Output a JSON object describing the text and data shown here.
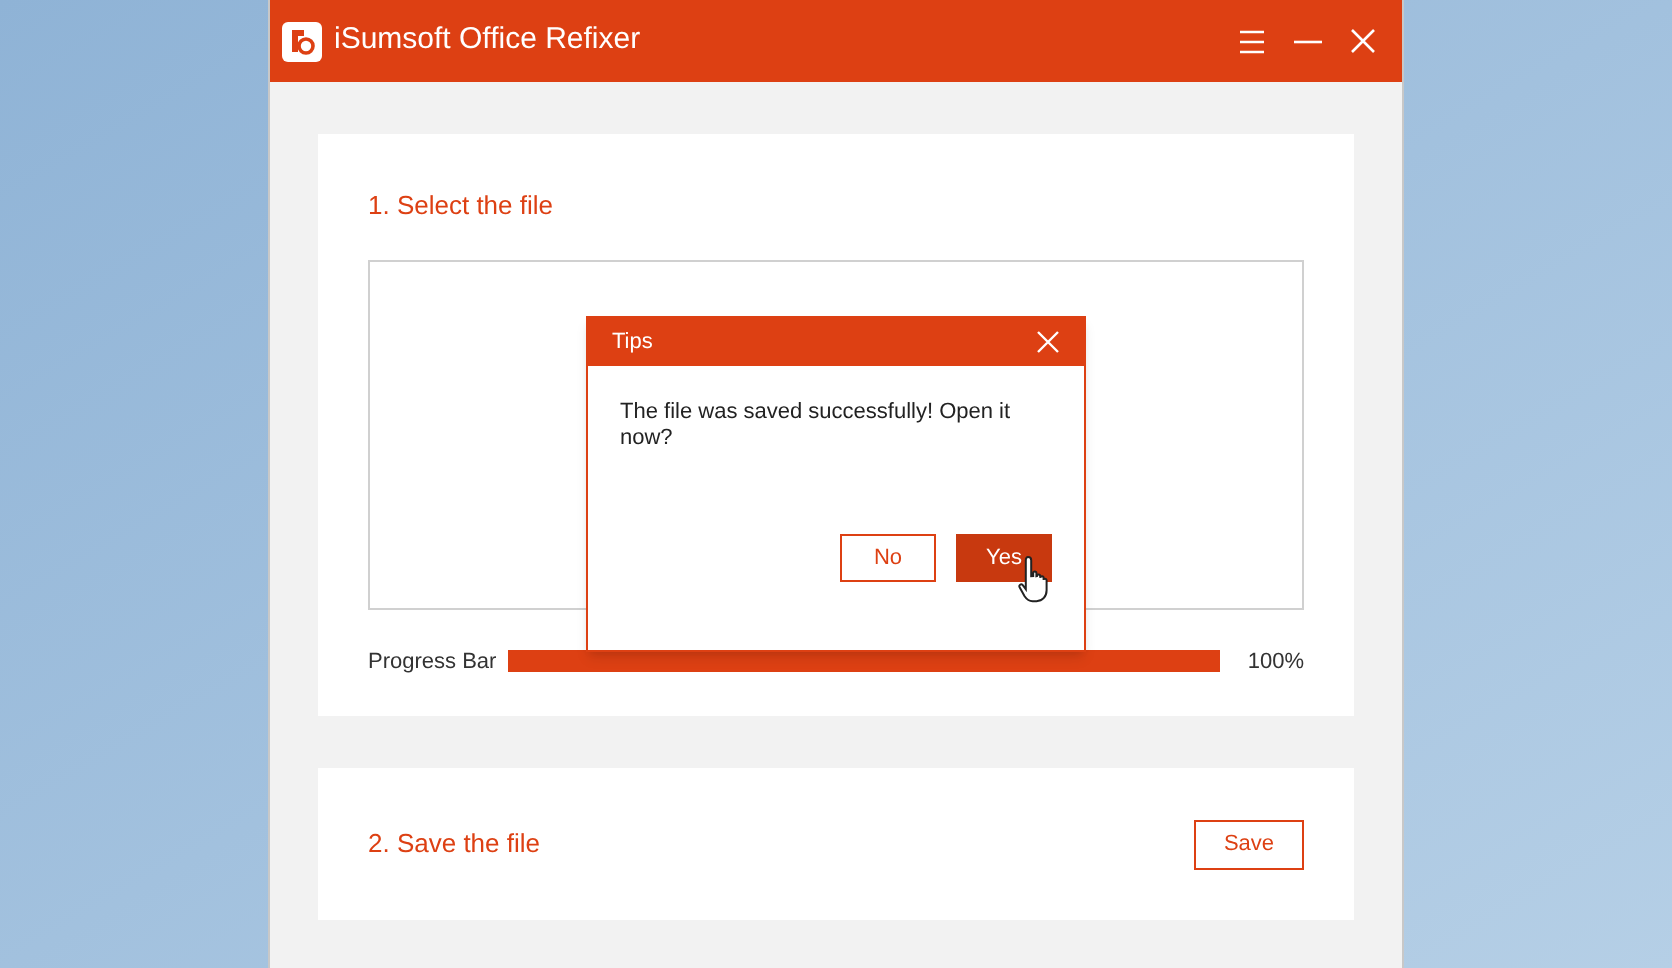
{
  "window": {
    "title": "iSumsoft Office Refixer"
  },
  "step1": {
    "title": "1. Select the file",
    "progress": {
      "label": "Progress Bar",
      "level": 1,
      "reading": "100%"
    }
  },
  "step2": {
    "title": "2. Save the file",
    "button": "Save"
  },
  "dialog": {
    "title": "Tips",
    "message": "The file was saved successfully! Open it now?",
    "buttons": [
      {
        "label": "No",
        "primary": false
      },
      {
        "label": "Yes",
        "primary": true
      }
    ]
  }
}
